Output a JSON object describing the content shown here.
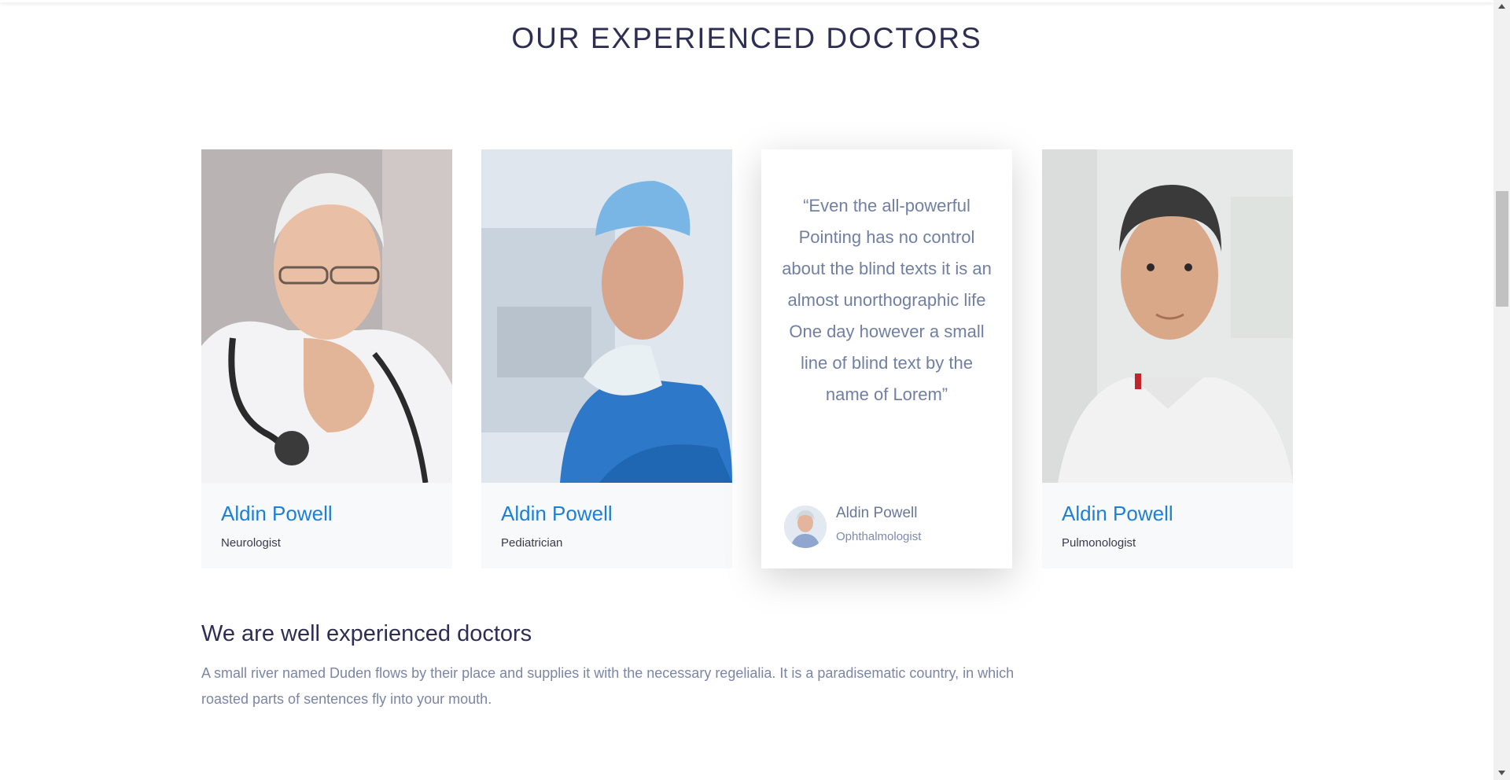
{
  "section": {
    "title": "OUR EXPERIENCED DOCTORS"
  },
  "doctors": [
    {
      "name": "Aldin Powell",
      "role": "Neurologist"
    },
    {
      "name": "Aldin Powell",
      "role": "Pediatrician"
    },
    {
      "name": "Aldin Powell",
      "role": "Pulmonologist"
    }
  ],
  "testimonial": {
    "quote": "“Even the all-powerful Pointing has no control about the blind texts it is an almost unorthographic life One day however a small line of blind text by the name of Lorem”",
    "name": "Aldin Powell",
    "role": "Ophthalmologist"
  },
  "about": {
    "title": "We are well experienced doctors",
    "text": "A small river named Duden flows by their place and supplies it with the necessary regelialia. It is a paradisematic country, in which roasted parts of sentences fly into your mouth."
  },
  "colors": {
    "name_link": "#1d7fd6",
    "heading": "#2e2e52",
    "body_text": "#7b85a6"
  },
  "icons": {
    "scroll_up": "triangle-up-icon",
    "scroll_down": "triangle-down-icon"
  }
}
